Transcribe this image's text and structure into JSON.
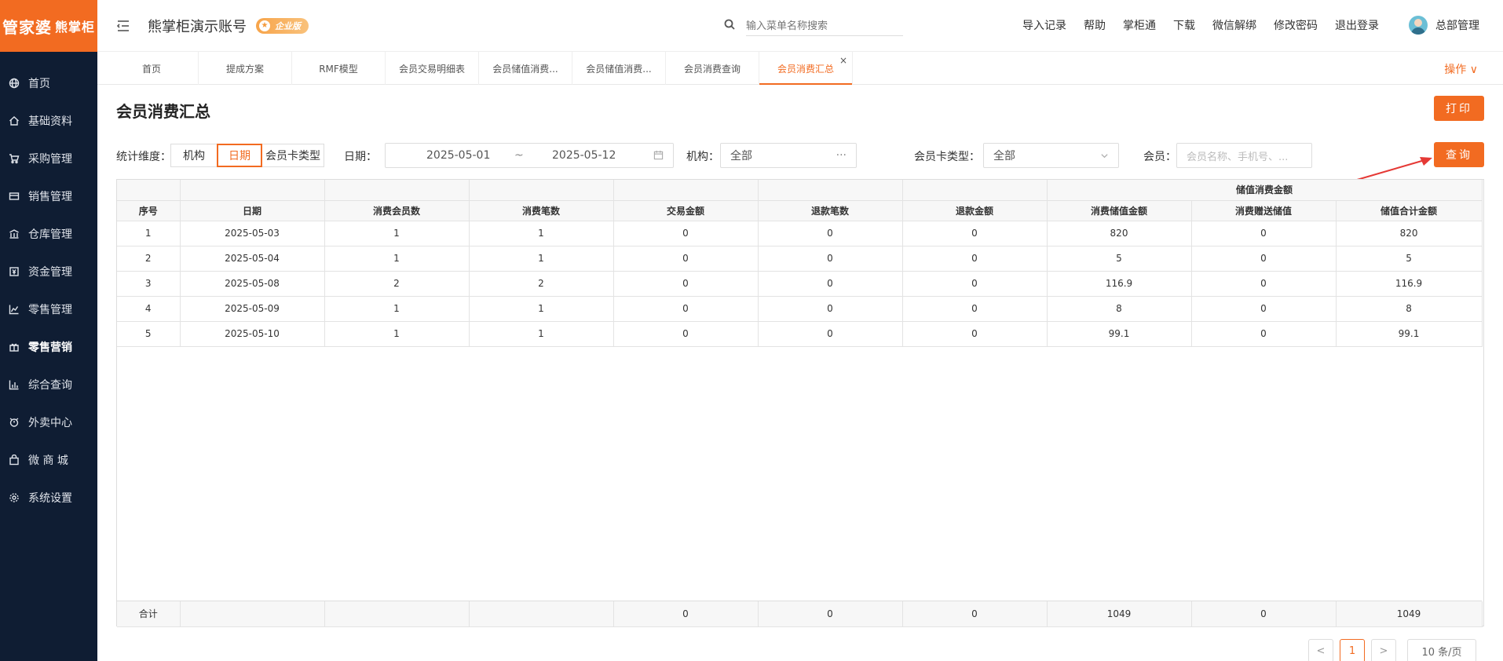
{
  "logo": {
    "main": "管家婆",
    "sub": "熊掌柜"
  },
  "sidebar": {
    "items": [
      {
        "label": "首页",
        "icon": "globe-icon",
        "active": false
      },
      {
        "label": "基础资料",
        "icon": "home-icon",
        "active": false
      },
      {
        "label": "采购管理",
        "icon": "cart-icon",
        "active": false
      },
      {
        "label": "销售管理",
        "icon": "card-icon",
        "active": false
      },
      {
        "label": "仓库管理",
        "icon": "bank-icon",
        "active": false
      },
      {
        "label": "资金管理",
        "icon": "money-icon",
        "active": false
      },
      {
        "label": "零售管理",
        "icon": "chart-icon",
        "active": false
      },
      {
        "label": "零售营销",
        "icon": "gift-icon",
        "active": true
      },
      {
        "label": "综合查询",
        "icon": "bar-chart-icon",
        "active": false
      },
      {
        "label": "外卖中心",
        "icon": "alarm-icon",
        "active": false
      },
      {
        "label": "微 商 城",
        "icon": "bag-icon",
        "active": false
      },
      {
        "label": "系统设置",
        "icon": "gear-icon",
        "active": false
      }
    ]
  },
  "header": {
    "account_name": "熊掌柜演示账号",
    "edition_badge": "企业版",
    "search_placeholder": "输入菜单名称搜索",
    "links": [
      "导入记录",
      "帮助",
      "掌柜通",
      "下载",
      "微信解绑",
      "修改密码",
      "退出登录"
    ],
    "user_name": "总部管理"
  },
  "tabs": {
    "items": [
      "首页",
      "提成方案",
      "RMF模型",
      "会员交易明细表",
      "会员储值消费...",
      "会员储值消费...",
      "会员消费查询",
      "会员消费汇总"
    ],
    "active_index": 7,
    "close_icon": "×",
    "ops_label": "操作 ∨"
  },
  "page": {
    "title": "会员消费汇总",
    "print_label": "打印",
    "query_label": "查询"
  },
  "filters": {
    "dimension_label": "统计维度：",
    "dimension_options": [
      "机构",
      "日期",
      "会员卡类型"
    ],
    "dimension_selected": "日期",
    "date_label": "日期：",
    "date_start": "2025-05-01",
    "date_sep": "~",
    "date_end": "2025-05-12",
    "org_label": "机构：",
    "org_value": "全部",
    "org_more": "···",
    "card_type_label": "会员卡类型：",
    "card_type_value": "全部",
    "member_label": "会员：",
    "member_placeholder": "会员名称、手机号、..."
  },
  "table": {
    "group_header": "储值消费金额",
    "columns": [
      "序号",
      "日期",
      "消费会员数",
      "消费笔数",
      "交易金额",
      "退款笔数",
      "退款金额",
      "消费储值金额",
      "消费赠送储值",
      "储值合计金额"
    ],
    "rows": [
      [
        "1",
        "2025-05-03",
        "1",
        "1",
        "0",
        "0",
        "0",
        "820",
        "0",
        "820"
      ],
      [
        "2",
        "2025-05-04",
        "1",
        "1",
        "0",
        "0",
        "0",
        "5",
        "0",
        "5"
      ],
      [
        "3",
        "2025-05-08",
        "2",
        "2",
        "0",
        "0",
        "0",
        "116.9",
        "0",
        "116.9"
      ],
      [
        "4",
        "2025-05-09",
        "1",
        "1",
        "0",
        "0",
        "0",
        "8",
        "0",
        "8"
      ],
      [
        "5",
        "2025-05-10",
        "1",
        "1",
        "0",
        "0",
        "0",
        "99.1",
        "0",
        "99.1"
      ]
    ],
    "footer": [
      "合计",
      "",
      "",
      "",
      "0",
      "0",
      "0",
      "1049",
      "0",
      "1049"
    ]
  },
  "pagination": {
    "prev": "<",
    "current": "1",
    "next": ">",
    "page_size": "10 条/页"
  },
  "colors": {
    "accent": "#f26b21",
    "sidebar_bg": "#0f1d33"
  }
}
